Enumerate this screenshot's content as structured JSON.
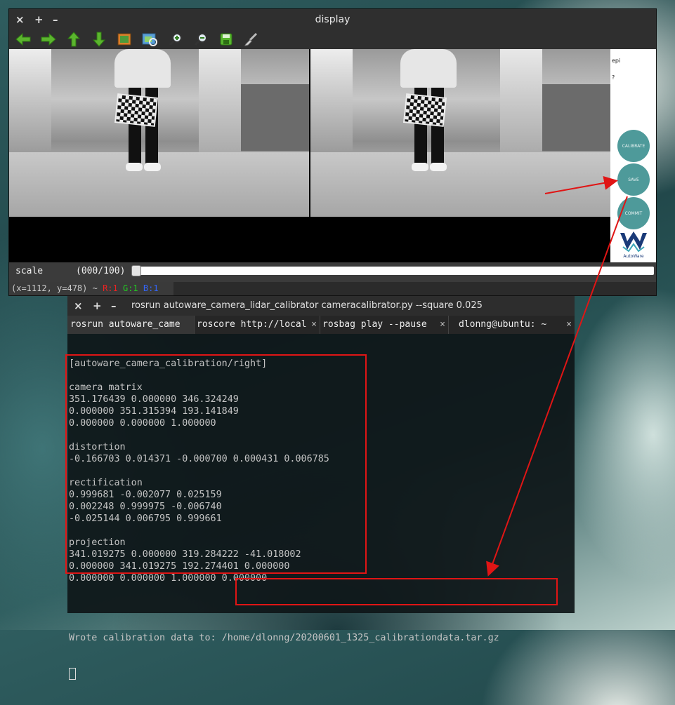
{
  "display_window": {
    "title": "display",
    "controls": {
      "close": "×",
      "maximize": "+",
      "minimize": "–"
    },
    "toolbar": [
      "arrow-left",
      "arrow-right",
      "arrow-up",
      "arrow-down",
      "image",
      "image-fit",
      "zoom-in",
      "zoom-out",
      "save",
      "brush"
    ],
    "side_panel": {
      "top_text_1": "epi",
      "top_text_2": "?",
      "buttons": [
        "CALIBRATE",
        "SAVE",
        "COMMIT"
      ],
      "logo_text": "AutoWare"
    },
    "scale_label": "scale",
    "scale_value": "(000/100)",
    "scale_level": 0,
    "status_coords": "(x=1112, y=478) ~",
    "status_r": "R:1",
    "status_g": "G:1",
    "status_b": "B:1"
  },
  "terminal": {
    "title": "rosrun autoware_camera_lidar_calibrator cameracalibrator.py --square 0.025",
    "controls": {
      "close": "×",
      "add": "+",
      "minimize": "–"
    },
    "tabs": [
      "rosrun autoware_came",
      "roscore http://local",
      "rosbag play --pause",
      "dlonng@ubuntu: ~"
    ],
    "lines": [
      "[autoware_camera_calibration/right]",
      "",
      "camera matrix",
      "351.176439 0.000000 346.324249",
      "0.000000 351.315394 193.141849",
      "0.000000 0.000000 1.000000",
      "",
      "distortion",
      "-0.166703 0.014371 -0.000700 0.000431 0.006785",
      "",
      "rectification",
      "0.999681 -0.002077 0.025159",
      "0.002248 0.999975 -0.006740",
      "-0.025144 0.006795 0.999661",
      "",
      "projection",
      "341.019275 0.000000 319.284222 -41.018002",
      "0.000000 341.019275 192.274401 0.000000",
      "0.000000 0.000000 1.000000 0.000000",
      "",
      ""
    ],
    "wrote_label": "Wrote calibration data to: ",
    "wrote_path": "/home/dlonng/20200601_1325_calibrationdata.tar.gz"
  },
  "colors": {
    "annotation": "#e01515",
    "button": "#4e9a9a"
  }
}
